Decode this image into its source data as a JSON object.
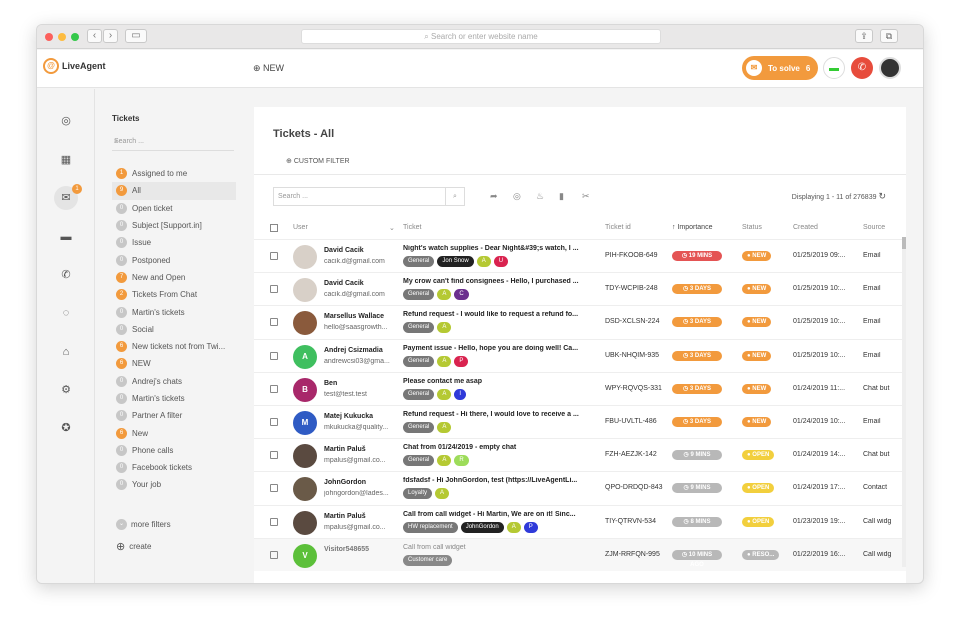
{
  "browser": {
    "url_placeholder": "Search or enter website name"
  },
  "header": {
    "logo": "LiveAgent",
    "new_label": "NEW",
    "to_solve_label": "To solve",
    "to_solve_count": "6"
  },
  "sidebar": {
    "title": "Tickets",
    "search_placeholder": "Search ...",
    "filters": [
      {
        "count": "1",
        "label": "Assigned to me",
        "hl": true
      },
      {
        "count": "9",
        "label": "All",
        "hl": true
      },
      {
        "count": "0",
        "label": "Open ticket",
        "hl": false
      },
      {
        "count": "0",
        "label": "Subject [Support.in]",
        "hl": false
      },
      {
        "count": "0",
        "label": "Issue",
        "hl": false
      },
      {
        "count": "0",
        "label": "Postponed",
        "hl": false
      },
      {
        "count": "7",
        "label": "New and Open",
        "hl": true
      },
      {
        "count": "2",
        "label": "Tickets From Chat",
        "hl": true
      },
      {
        "count": "0",
        "label": "Martin's tickets",
        "hl": false
      },
      {
        "count": "0",
        "label": "Social",
        "hl": false
      },
      {
        "count": "6",
        "label": "New tickets not from Twi...",
        "hl": true
      },
      {
        "count": "6",
        "label": "NEW",
        "hl": true
      },
      {
        "count": "0",
        "label": "Andrej's chats",
        "hl": false
      },
      {
        "count": "0",
        "label": "Martin's tickets",
        "hl": false
      },
      {
        "count": "0",
        "label": "Partner A filter",
        "hl": false
      },
      {
        "count": "6",
        "label": "New",
        "hl": true
      },
      {
        "count": "0",
        "label": "Phone calls",
        "hl": false
      },
      {
        "count": "0",
        "label": "Facebook tickets",
        "hl": false
      },
      {
        "count": "0",
        "label": "Your job",
        "hl": false
      }
    ],
    "more_filters": "more filters",
    "create": "create",
    "mail_badge": "1"
  },
  "main": {
    "title": "Tickets - All",
    "custom_filter": "CUSTOM FILTER",
    "search_placeholder": "Search ...",
    "displaying": "Displaying 1 - 11 of 276839",
    "columns": {
      "user": "User",
      "ticket": "Ticket",
      "ticket_id": "Ticket id",
      "importance": "Importance",
      "status": "Status",
      "created": "Created",
      "source": "Source"
    }
  },
  "rows": [
    {
      "initial": "",
      "avatar_color": "#d8d0c8",
      "name": "David Cacik",
      "email": "cacik.d@gmail.com",
      "subject": "Night's watch supplies - Dear Night&#39;s watch, I ...",
      "tags": [
        {
          "t": "General",
          "c": "#777"
        },
        {
          "t": "Jon Snow",
          "c": "#222"
        },
        {
          "t": "A",
          "c": "#b5c933"
        },
        {
          "t": "U",
          "c": "#d9234f"
        }
      ],
      "id": "PIH-FKOOB-649",
      "importance": "19 MINS",
      "imp_color": "#e45454",
      "status": "NEW",
      "status_color": "#f29a3d",
      "created": "01/25/2019 09:...",
      "source": "Email"
    },
    {
      "initial": "",
      "avatar_color": "#d8d0c8",
      "name": "David Cacik",
      "email": "cacik.d@gmail.com",
      "subject": "My crow can't find consignees - Hello, I purchased ...",
      "tags": [
        {
          "t": "General",
          "c": "#777"
        },
        {
          "t": "A",
          "c": "#b5c933"
        },
        {
          "t": "C",
          "c": "#6b2f8e"
        }
      ],
      "id": "TDY-WCPIB-248",
      "importance": "3 DAYS",
      "imp_color": "#f29a3d",
      "status": "NEW",
      "status_color": "#f29a3d",
      "created": "01/25/2019 10:...",
      "source": "Email"
    },
    {
      "initial": "",
      "avatar_color": "#8a5a3c",
      "name": "Marsellus Wallace",
      "email": "hello@saasgrowth...",
      "subject": "Refund request - I would like to request a refund fo...",
      "tags": [
        {
          "t": "General",
          "c": "#777"
        },
        {
          "t": "A",
          "c": "#b5c933"
        }
      ],
      "id": "DSD-XCLSN-224",
      "importance": "3 DAYS",
      "imp_color": "#f29a3d",
      "status": "NEW",
      "status_color": "#f29a3d",
      "created": "01/25/2019 10:...",
      "source": "Email"
    },
    {
      "initial": "A",
      "avatar_color": "#3fbf5f",
      "name": "Andrej Csizmadia",
      "email": "andrewcsi03@gma...",
      "subject": "Payment issue - Hello, hope you are doing well! Ca...",
      "tags": [
        {
          "t": "General",
          "c": "#777"
        },
        {
          "t": "A",
          "c": "#b5c933"
        },
        {
          "t": "P",
          "c": "#d9234f"
        }
      ],
      "id": "UBK-NHQIM-935",
      "importance": "3 DAYS",
      "imp_color": "#f29a3d",
      "status": "NEW",
      "status_color": "#f29a3d",
      "created": "01/25/2019 10:...",
      "source": "Email"
    },
    {
      "initial": "B",
      "avatar_color": "#a8286a",
      "name": "Ben",
      "email": "test@test.test",
      "subject": "Please contact me asap",
      "tags": [
        {
          "t": "General",
          "c": "#777"
        },
        {
          "t": "A",
          "c": "#b5c933"
        },
        {
          "t": "I",
          "c": "#2f3ad9"
        }
      ],
      "id": "WPY-RQVQS-331",
      "importance": "3 DAYS",
      "imp_color": "#f29a3d",
      "status": "NEW",
      "status_color": "#f29a3d",
      "created": "01/24/2019 11:...",
      "source": "Chat but"
    },
    {
      "initial": "M",
      "avatar_color": "#2f5bc4",
      "name": "Matej Kukucka",
      "email": "mkukucka@quality...",
      "subject": "Refund request - Hi there, I would love to receive a ...",
      "tags": [
        {
          "t": "General",
          "c": "#777"
        },
        {
          "t": "A",
          "c": "#b5c933"
        }
      ],
      "id": "FBU-UVLTL-486",
      "importance": "3 DAYS",
      "imp_color": "#f29a3d",
      "status": "NEW",
      "status_color": "#f29a3d",
      "created": "01/24/2019 10:...",
      "source": "Email"
    },
    {
      "initial": "",
      "avatar_color": "#5a4a40",
      "name": "Martin Paluš",
      "email": "mpalus@gmail.co...",
      "subject": "Chat from 01/24/2019 - empty chat",
      "tags": [
        {
          "t": "General",
          "c": "#777"
        },
        {
          "t": "A",
          "c": "#b5c933"
        },
        {
          "t": "R",
          "c": "#9ddc5a"
        }
      ],
      "id": "FZH-AEZJK-142",
      "importance": "9 MINS AGO",
      "imp_color": "#b8b8b8",
      "status": "OPEN",
      "status_color": "#f2cf3d",
      "created": "01/24/2019 14:...",
      "source": "Chat but"
    },
    {
      "initial": "",
      "avatar_color": "#6a5a48",
      "name": "JohnGordon",
      "email": "johngordon@lades...",
      "subject": "fdsfadsf - Hi JohnGordon, test (https://LiveAgentLi...",
      "tags": [
        {
          "t": "Loyalty",
          "c": "#777"
        },
        {
          "t": "A",
          "c": "#b5c933"
        }
      ],
      "id": "QPO-DRDQD-843",
      "importance": "9 MINS AGO",
      "imp_color": "#b8b8b8",
      "status": "OPEN",
      "status_color": "#f2cf3d",
      "created": "01/24/2019 17:...",
      "source": "Contact"
    },
    {
      "initial": "",
      "avatar_color": "#5a4a40",
      "name": "Martin Paluš",
      "email": "mpalus@gmail.co...",
      "subject": "Call from call widget - Hi Martin, We are on it! Sinc...",
      "tags": [
        {
          "t": "HW replacement",
          "c": "#777"
        },
        {
          "t": "JohnGordon",
          "c": "#222"
        },
        {
          "t": "A",
          "c": "#b5c933"
        },
        {
          "t": "P",
          "c": "#2f3ad9"
        }
      ],
      "id": "TIY-QTRVN-534",
      "importance": "8 MINS AGO",
      "imp_color": "#b8b8b8",
      "status": "OPEN",
      "status_color": "#f2cf3d",
      "created": "01/23/2019 19:...",
      "source": "Call widg"
    },
    {
      "initial": "V",
      "avatar_color": "#5cc03a",
      "name": "Visitor548655",
      "email": "",
      "subject": "Call from call widget",
      "tags": [
        {
          "t": "Customer care",
          "c": "#888"
        }
      ],
      "id": "ZJM-RRFQN-995",
      "importance": "10 MINS AGO",
      "imp_color": "#b8b8b8",
      "status": "RESO...",
      "status_color": "#b8b8b8",
      "created": "01/22/2019 16:...",
      "source": "Call widg"
    }
  ]
}
